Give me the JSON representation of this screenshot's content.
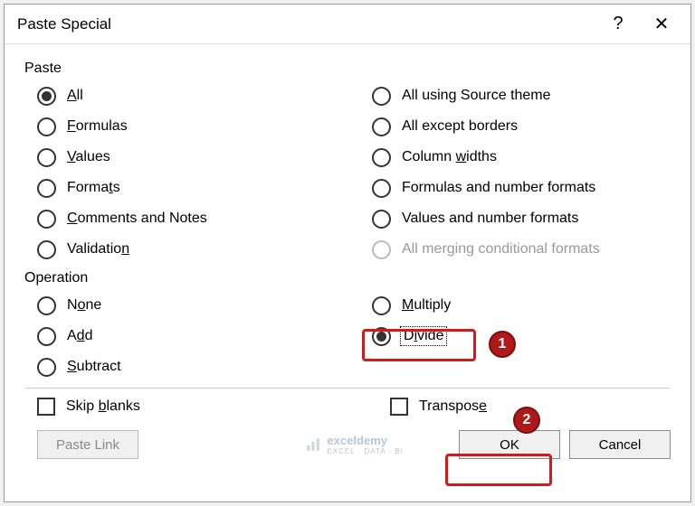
{
  "dialog": {
    "title": "Paste Special",
    "help_glyph": "?",
    "close_glyph": "✕"
  },
  "paste": {
    "label": "Paste",
    "left": [
      {
        "text": "All",
        "u": "A",
        "rest": "ll",
        "checked": true
      },
      {
        "text": "Formulas",
        "u": "F",
        "rest": "ormulas",
        "checked": false
      },
      {
        "text": "Values",
        "u": "V",
        "rest": "alues",
        "checked": false
      },
      {
        "text": "Formats",
        "u": "",
        "rest": "Forma",
        "tail_u": "t",
        "tail": "s",
        "checked": false
      },
      {
        "text": "Comments and Notes",
        "u": "C",
        "rest": "omments and Notes",
        "checked": false
      },
      {
        "text": "Validation",
        "pre": "Validatio",
        "u": "n",
        "checked": false
      }
    ],
    "right": [
      {
        "text": "All using Source theme",
        "checked": false
      },
      {
        "text": "All except borders",
        "checked": false
      },
      {
        "text": "Column widths",
        "pre": "Column ",
        "u": "w",
        "rest": "idths",
        "checked": false
      },
      {
        "text": "Formulas and number formats",
        "checked": false
      },
      {
        "text": "Values and number formats",
        "checked": false
      },
      {
        "text": "All merging conditional formats",
        "checked": false,
        "disabled": true
      }
    ]
  },
  "operation": {
    "label": "Operation",
    "left": [
      {
        "text": "None",
        "pre": "N",
        "u": "o",
        "rest": "ne",
        "checked": false
      },
      {
        "text": "Add",
        "pre": "A",
        "u": "d",
        "rest": "d",
        "checked": false
      },
      {
        "text": "Subtract",
        "u": "S",
        "rest": "ubtract",
        "checked": false
      }
    ],
    "right": [
      {
        "text": "Multiply",
        "u": "M",
        "rest": "ultiply",
        "checked": false
      },
      {
        "text": "Divide",
        "pre": "D",
        "u": "i",
        "rest": "vide",
        "checked": true,
        "focused": true
      }
    ]
  },
  "checks": {
    "skip_blanks": {
      "label": "Skip blanks",
      "pre": "Skip ",
      "u": "b",
      "rest": "lanks",
      "checked": false
    },
    "transpose": {
      "label": "Transpose",
      "pre": "Transpos",
      "u": "e",
      "rest": "",
      "checked": false
    }
  },
  "buttons": {
    "paste_link": "Paste Link",
    "ok": "OK",
    "cancel": "Cancel"
  },
  "watermark": {
    "name": "exceldemy",
    "sub": "EXCEL · DATA · BI"
  },
  "callouts": {
    "one": "1",
    "two": "2"
  }
}
